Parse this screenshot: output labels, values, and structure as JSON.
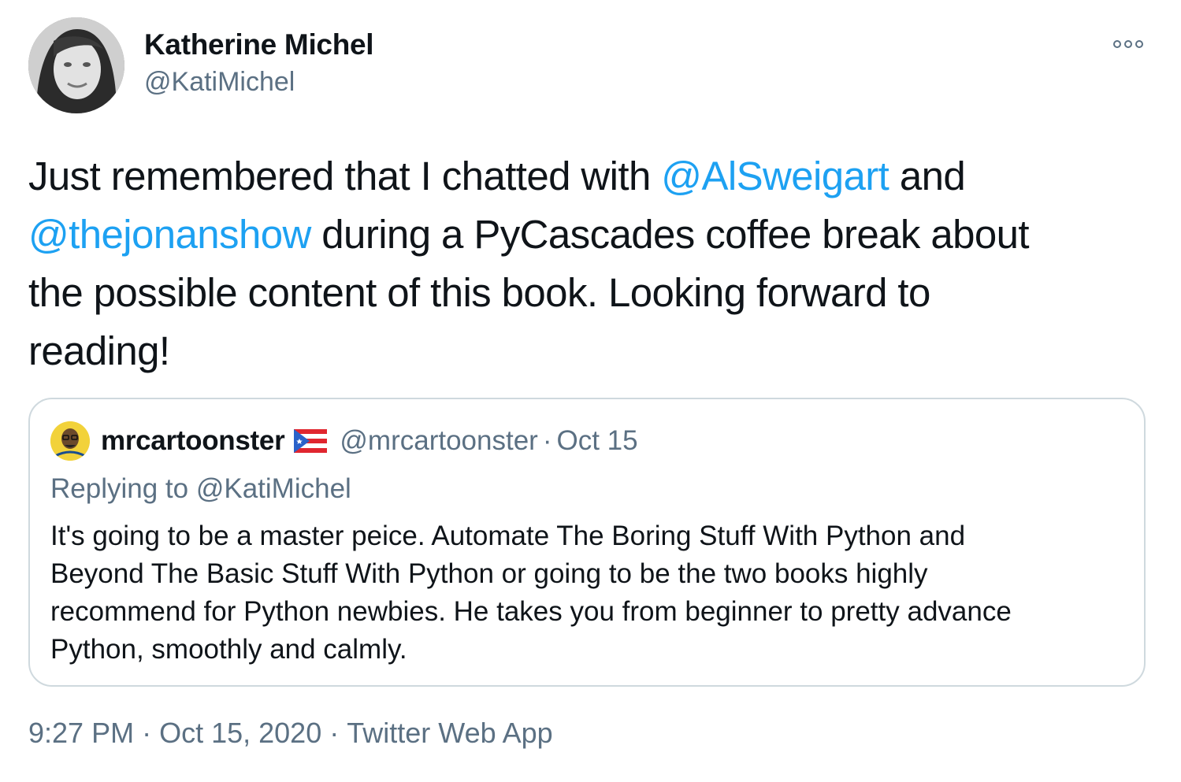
{
  "author": {
    "name": "Katherine Michel",
    "handle": "@KatiMichel"
  },
  "more_icon": "more-horizontal-icon",
  "tweet": {
    "lines": [
      [
        {
          "text": "Just remembered that I chatted with ",
          "mention": false
        },
        {
          "text": "@AlSweigart",
          "mention": true
        },
        {
          "text": " and",
          "mention": false
        }
      ],
      [
        {
          "text": "@thejonanshow",
          "mention": true
        },
        {
          "text": " during a PyCascades coffee break about",
          "mention": false
        }
      ],
      [
        {
          "text": "the possible content of this book. Looking forward to",
          "mention": false
        }
      ],
      [
        {
          "text": "reading!",
          "mention": false
        }
      ]
    ]
  },
  "quote": {
    "name": "mrcartoonster",
    "flag_icon": "puerto-rico-flag-icon",
    "handle": "@mrcartoonster",
    "separator": "·",
    "date": "Oct 15",
    "replying_to": "Replying to @KatiMichel",
    "body_lines": [
      "It's going to be a master peice. Automate The Boring Stuff With Python and",
      "Beyond The Basic Stuff With Python or going to be the two books highly",
      "recommend for Python newbies. He takes you from beginner to pretty advance",
      "Python, smoothly and calmly."
    ]
  },
  "meta": {
    "time": "9:27 PM",
    "separator": "·",
    "date": "Oct 15, 2020",
    "source": "Twitter Web App"
  },
  "colors": {
    "text": "#0f1419",
    "secondary": "#5b7083",
    "link": "#1da1f2",
    "border": "#cfd9de"
  }
}
